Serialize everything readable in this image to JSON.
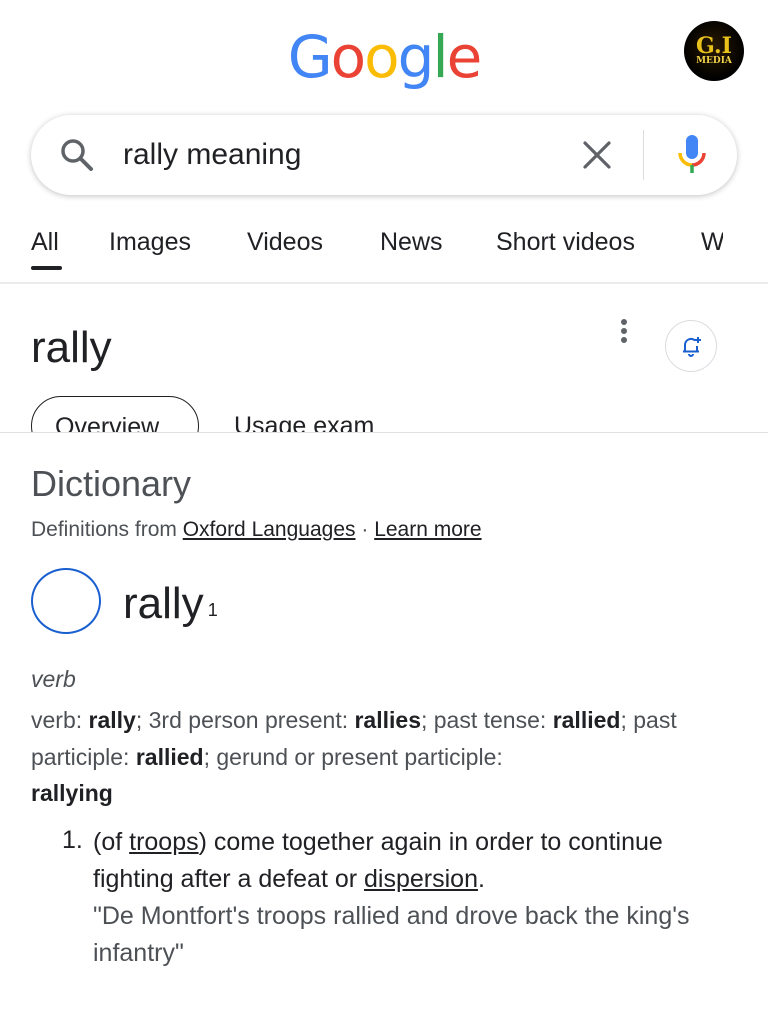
{
  "logo": {
    "letters": [
      "G",
      "o",
      "o",
      "g",
      "l",
      "e"
    ],
    "colors": [
      "#4285F4",
      "#EA4335",
      "#FBBC05",
      "#4285F4",
      "#34A853",
      "#EA4335"
    ]
  },
  "avatar": {
    "line1": "G.I",
    "line2": "MEDIA"
  },
  "search": {
    "query": "rally meaning",
    "icons": [
      "search-icon",
      "close-icon",
      "mic-icon"
    ]
  },
  "tabs": [
    {
      "label": "All",
      "active": true
    },
    {
      "label": "Images"
    },
    {
      "label": "Videos"
    },
    {
      "label": "News"
    },
    {
      "label": "Short videos"
    },
    {
      "label": "W"
    }
  ],
  "card": {
    "title": "rally",
    "chips": [
      "Overview",
      "Usage exam"
    ]
  },
  "dictionary": {
    "heading": "Dictionary",
    "source_prefix": "Definitions from ",
    "source_link": "Oxford Languages",
    "source_sep": " · ",
    "learn_more": "Learn more",
    "headword": "rally",
    "superscript": "1",
    "part_of_speech": "verb",
    "forms": {
      "verb_label": "verb: ",
      "verb": "rally",
      "third_label": "; 3rd person present: ",
      "third": "rallies",
      "past_label": "; past tense: ",
      "past": "rallied",
      "pp_label": "; past participle: ",
      "pp": "rallied",
      "ger_label": "; gerund or present participle: ",
      "ger": "rallying"
    },
    "definition": {
      "number": "1.",
      "text_1": "(of ",
      "link_1": "troops",
      "text_2": ") come together again in order to continue fighting after a defeat or ",
      "link_2": "dispersion",
      "text_3": ".",
      "example": "\"De Montfort's troops rallied and drove back the king's infantry\""
    }
  },
  "colors": {
    "accent": "#1a5fd0",
    "text": "#202124",
    "muted": "#4d5156"
  }
}
